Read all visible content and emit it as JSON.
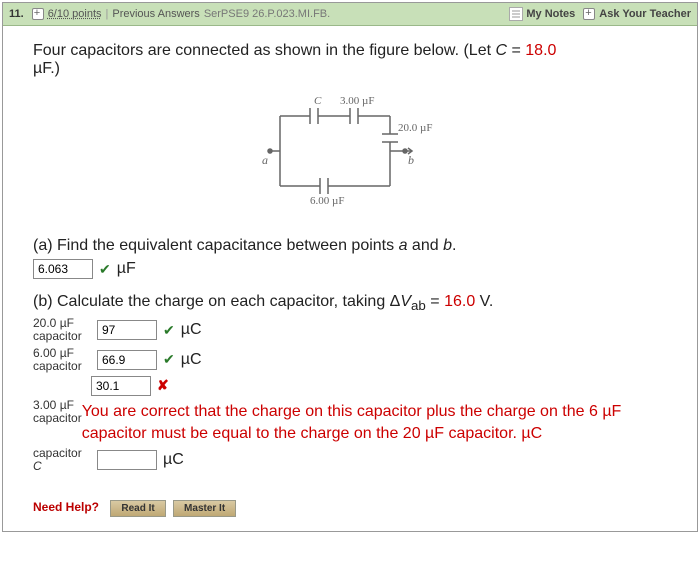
{
  "header": {
    "question_number": "11.",
    "points": "6/10 points",
    "prev_answers": "Previous Answers",
    "source": "SerPSE9 26.P.023.MI.FB.",
    "my_notes": "My Notes",
    "ask_teacher": "Ask Your Teacher"
  },
  "intro": {
    "text_before_c": "Four capacitors are connected as shown in the figure below. (Let ",
    "c_var": "C",
    "equals": " = ",
    "c_value": "18.0",
    "unit_line": "µF.)"
  },
  "figure": {
    "c_top_left": "C",
    "c_top_right": "3.00 µF",
    "c_right": "20.0 µF",
    "c_bottom": "6.00 µF",
    "node_a": "a",
    "node_b": "b"
  },
  "part_a": {
    "prompt_before": "(a) Find the equivalent capacitance between points ",
    "a": "a",
    "and": " and ",
    "b": "b",
    "after": ".",
    "value": "6.063",
    "unit": "µF"
  },
  "part_b": {
    "prompt_before": "(b) Calculate the charge on each capacitor, taking Δ",
    "vab": "V",
    "ab": "ab",
    "equals": " = ",
    "dv_value": "16.0",
    "volts": " V.",
    "rows": {
      "r1_label_top": "20.0 µF",
      "r1_label_bot": "capacitor",
      "r1_value": "97",
      "r2_label_top": "6.00 µF",
      "r2_label_bot": "capacitor",
      "r2_value": "66.9",
      "r3_value": "30.1",
      "r3_label_top": "3.00 µF",
      "r3_label_bot": "capacitor",
      "r4_label_top": "capacitor",
      "r4_label_bot": "C",
      "r4_value": ""
    },
    "unit": "µC",
    "feedback": "You are correct that the charge on this capacitor plus the charge on the 6 µF capacitor must be equal to the charge on the 20 µF capacitor. µC"
  },
  "help": {
    "need_help": "Need Help?",
    "read_it": "Read It",
    "master_it": "Master It"
  }
}
